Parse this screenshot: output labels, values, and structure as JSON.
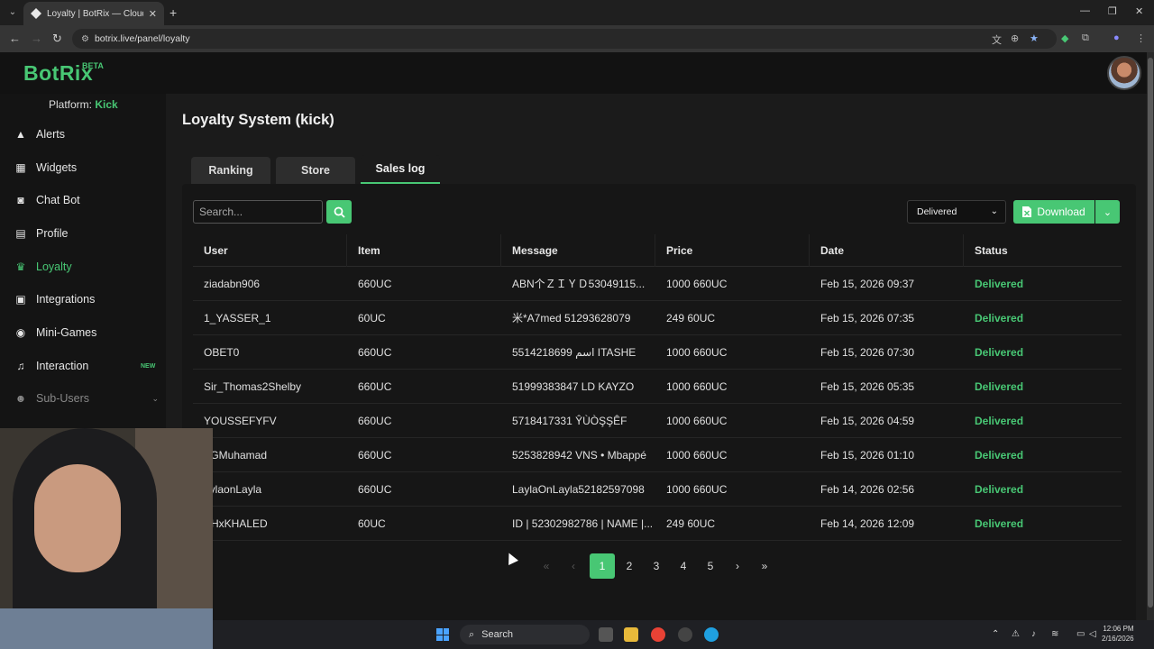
{
  "browser": {
    "tab_title": "Loyalty | BotRix — Cloud Strea",
    "url": "botrix.live/panel/loyalty"
  },
  "brand": {
    "logo": "BotRix",
    "badge": "BETA",
    "accent_color": "#48c774"
  },
  "platform": {
    "label": "Platform:",
    "value": "Kick"
  },
  "sidebar": {
    "items": [
      {
        "label": "Alerts",
        "icon": "warning-icon"
      },
      {
        "label": "Widgets",
        "icon": "grid-icon"
      },
      {
        "label": "Chat Bot",
        "icon": "robot-icon"
      },
      {
        "label": "Profile",
        "icon": "id-card-icon"
      },
      {
        "label": "Loyalty",
        "icon": "trophy-icon"
      },
      {
        "label": "Integrations",
        "icon": "plug-icon"
      },
      {
        "label": "Mini-Games",
        "icon": "gamepad-icon"
      },
      {
        "label": "Interaction",
        "icon": "music-icon",
        "badge": "NEW"
      },
      {
        "label": "Sub-Users",
        "icon": "users-icon"
      }
    ]
  },
  "page": {
    "title": "Loyalty System (kick)",
    "tabs": [
      "Ranking",
      "Store",
      "Sales log"
    ],
    "active_tab": "Sales log"
  },
  "toolbar": {
    "search_placeholder": "Search...",
    "status_filter": "Delivered",
    "download_label": "Download"
  },
  "table": {
    "columns": [
      "User",
      "Item",
      "Message",
      "Price",
      "Date",
      "Status"
    ],
    "rows": [
      {
        "user": "ziadabn906",
        "item": "660UC",
        "message": "ABN个ＺＩＹＤ53049115...",
        "price": "1000 660UC",
        "date": "Feb 15, 2026 09:37",
        "status": "Delivered"
      },
      {
        "user": "1_YASSER_1",
        "item": "60UC",
        "message": "米*A7med 51293628079",
        "price": "249 60UC",
        "date": "Feb 15, 2026 07:35",
        "status": "Delivered"
      },
      {
        "user": "OBET0",
        "item": "660UC",
        "message": "5514218699 اسم ITASHE",
        "price": "1000 660UC",
        "date": "Feb 15, 2026 07:30",
        "status": "Delivered"
      },
      {
        "user": "Sir_Thomas2Shelby",
        "item": "660UC",
        "message": "51999383847 LD KAYZO",
        "price": "1000 660UC",
        "date": "Feb 15, 2026 05:35",
        "status": "Delivered"
      },
      {
        "user": "YOUSSEFYFV",
        "item": "660UC",
        "message": "5718417331 ŶÙÒŞŞÊF",
        "price": "1000 660UC",
        "date": "Feb 15, 2026 04:59",
        "status": "Delivered"
      },
      {
        "user": "TGMuhamad",
        "item": "660UC",
        "message": "5253828942 VNS • Mbappé",
        "price": "1000 660UC",
        "date": "Feb 15, 2026 01:10",
        "status": "Delivered"
      },
      {
        "user": "aylaonLayla",
        "item": "660UC",
        "message": "LaylaOnLayla52182597098",
        "price": "1000 660UC",
        "date": "Feb 14, 2026 02:56",
        "status": "Delivered"
      },
      {
        "user": "SHxKHALED",
        "item": "60UC",
        "message": "ID | 52302982786 | NAME |...",
        "price": "249 60UC",
        "date": "Feb 14, 2026 12:09",
        "status": "Delivered"
      }
    ]
  },
  "pagination": {
    "pages": [
      "1",
      "2",
      "3",
      "4",
      "5"
    ],
    "current": "1"
  },
  "taskbar": {
    "search_label": "Search",
    "time": "12:06 PM",
    "date": "2/16/2026"
  }
}
